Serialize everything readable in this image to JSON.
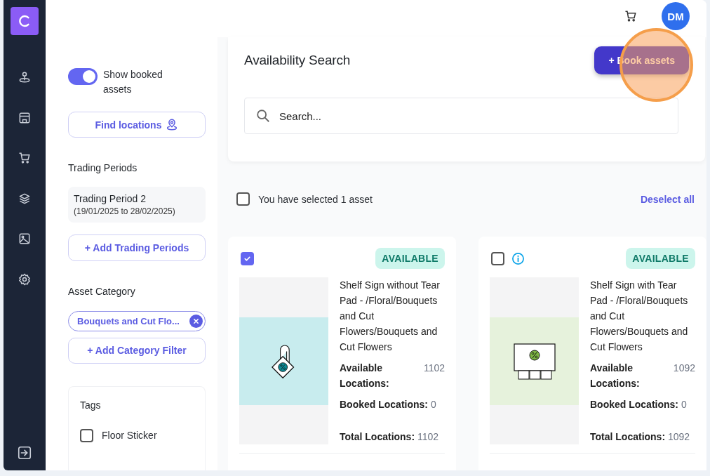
{
  "header": {
    "avatar": "DM"
  },
  "filters": {
    "show_booked": {
      "label": "Show booked assets",
      "on": true
    },
    "find_button": "Find locations",
    "trading_periods": {
      "heading": "Trading Periods",
      "items": [
        {
          "name": "Trading Period 2",
          "dates": "(19/01/2025 to 28/02/2025)"
        }
      ],
      "add_button": "+ Add Trading Periods"
    },
    "asset_category": {
      "heading": "Asset Category",
      "chips": [
        "Bouquets and Cut Flo..."
      ],
      "add_button": "+ Add Category Filter"
    },
    "tags": {
      "heading": "Tags",
      "items": [
        {
          "label": "Floor Sticker",
          "checked": false
        }
      ]
    }
  },
  "search": {
    "title": "Availability Search",
    "book_button": "+ Book assets",
    "placeholder": "Search..."
  },
  "selection": {
    "text": "You have selected 1 asset",
    "checked": false,
    "deselect": "Deselect all"
  },
  "assets": [
    {
      "selected": true,
      "info": false,
      "status": "AVAILABLE",
      "kind": "hanger",
      "title": "Shelf Sign without Tear Pad - /Floral/Bouquets and Cut Flowers/Bouquets and Cut Flowers",
      "available_label": "Available Locations:",
      "available": "1102",
      "booked_label": "Booked Locations:",
      "booked": "0",
      "total_label": "Total Locations:",
      "total": "1102"
    },
    {
      "selected": false,
      "info": true,
      "status": "AVAILABLE",
      "kind": "tear-pad",
      "title": "Shelf Sign with Tear Pad - /Floral/Bouquets and Cut Flowers/Bouquets and Cut Flowers",
      "available_label": "Available Locations:",
      "available": "1092",
      "booked_label": "Booked Locations:",
      "booked": "0",
      "total_label": "Total Locations:",
      "total": "1092"
    }
  ]
}
